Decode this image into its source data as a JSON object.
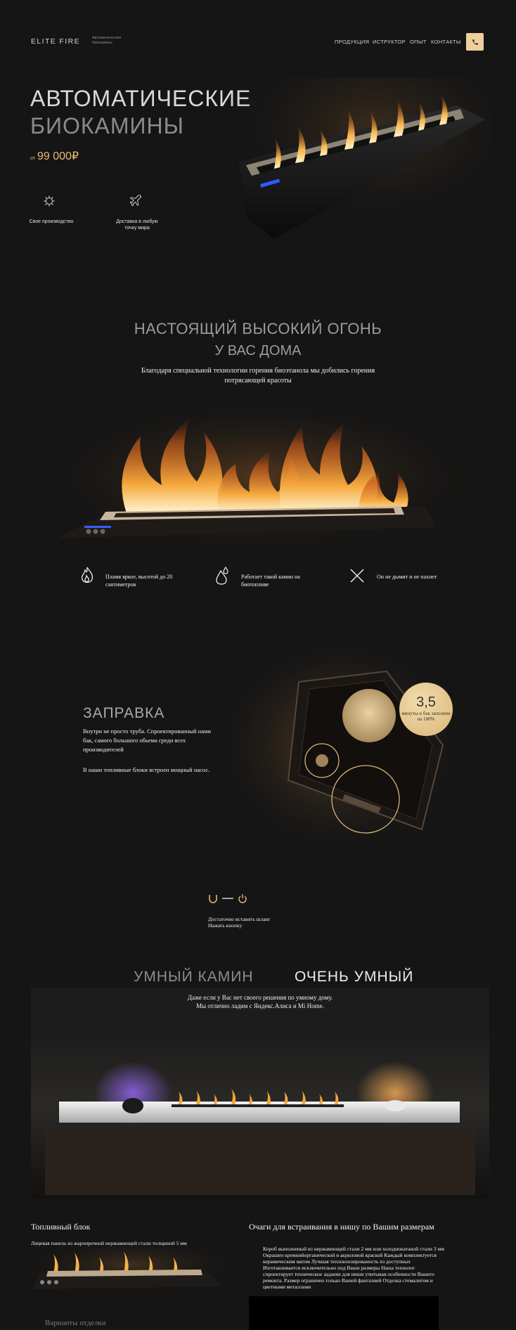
{
  "header": {
    "logo": "ELITE FIRE",
    "tagline": "Автоматические биокамины",
    "nav": [
      "ПРОДУКЦИЯ",
      "ИСТРУКТОР",
      "ОПЫТ",
      "КОНТАКТЫ"
    ],
    "phone_icon": "phone-icon"
  },
  "hero": {
    "title_line1": "АВТОМАТИЧЕСКИЕ",
    "title_line2": "БИОКАМИНЫ",
    "price_prefix": "от",
    "price": "99 000₽",
    "features": [
      {
        "icon": "gear-icon",
        "label": "Свое производство"
      },
      {
        "icon": "plane-icon",
        "label": "Доставка в любую точку мира"
      }
    ]
  },
  "fire_section": {
    "title_line1": "НАСТОЯЩИЙ ВЫСОКИЙ ОГОНЬ",
    "title_line2": "У ВАС ДОМА",
    "subtitle": "Благодаря специальной технологии горения биоэтанола мы добились горения потрясающей красоты",
    "features": [
      {
        "icon": "flame-icon",
        "text": "Пламя яркое, высотой до 20 сантиметров"
      },
      {
        "icon": "drops-icon",
        "text": "Работает такой камин на биотопливе"
      },
      {
        "icon": "cross-icon",
        "text": "Он не дымит и не пахнет"
      }
    ]
  },
  "refuel": {
    "title": "ЗАПРАВКА",
    "para1": "Внутри не просто труба. Спроектированный нами бак, самого большого обьема среди всех производителей",
    "para2": "В наши топливные блоки встроен мощный насос.",
    "badge_value": "3,5",
    "badge_text": "минуты и бак заполнен на 100%",
    "step_icons": [
      "magnet-icon",
      "power-icon"
    ],
    "steps": [
      "Достаточно вставить шланг",
      "Нажать кнопку"
    ]
  },
  "smart": {
    "title_left": "УМНЫЙ КАМИН",
    "title_right": "ОЧЕНЬ УМНЫЙ",
    "subtitle_line1": "Даже если у Вас нет своего решения по умному дому.",
    "subtitle_line2": "Мы отлично ладим с Яндекс.Алиса и Mi Home."
  },
  "fuel_block": {
    "title": "Топливный блок",
    "subtitle": "Лицевая панель из жаропрочной нержавеющей стали толщиной 5 мм",
    "variants": "Варианты отделки"
  },
  "niche": {
    "title": "Очаги для встраивания в нишу по Вашим размерам",
    "text": "Короб выполнeный из нержавеющей стали 2 мм или холоднокатаной стали 3 мм Окрашен кремнийорганической и акриловой краской Каждый комплектуется керамическим матом Лучшая теплоизолированость из доступных Изготавливается исключительно под Ваши размеры Наша технолог спроектирует техническое задание для ниши учитывая особенности Вашего ремонта. Размер ограничен только Вашей фантазией Отделка стемалитом и цветными металлами"
  },
  "colors": {
    "background": "#151515",
    "accent": "#efcf9c",
    "price": "#e8bb6e",
    "flame": "#f4a53b"
  }
}
